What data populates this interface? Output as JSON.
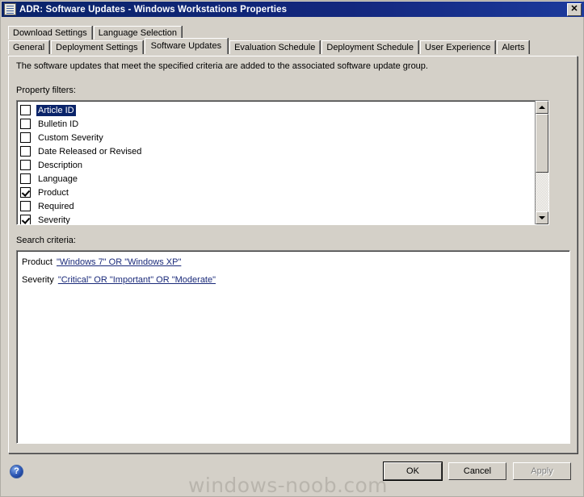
{
  "window": {
    "title": "ADR: Software Updates - Windows Workstations Properties",
    "icon": "properties-document-icon",
    "close_label": "✕"
  },
  "tabs": {
    "row1": [
      {
        "label": "Download Settings",
        "active": false
      },
      {
        "label": "Language Selection",
        "active": false
      }
    ],
    "row2": [
      {
        "label": "General",
        "active": false
      },
      {
        "label": "Deployment Settings",
        "active": false
      },
      {
        "label": "Software Updates",
        "active": true
      },
      {
        "label": "Evaluation Schedule",
        "active": false
      },
      {
        "label": "Deployment Schedule",
        "active": false
      },
      {
        "label": "User Experience",
        "active": false
      },
      {
        "label": "Alerts",
        "active": false
      }
    ]
  },
  "panel": {
    "description": "The software updates that meet the specified criteria are added to the associated software update group.",
    "property_filters_label": "Property filters:",
    "search_criteria_label": "Search criteria:"
  },
  "property_filters": [
    {
      "label": "Article ID",
      "checked": false,
      "selected": true
    },
    {
      "label": "Bulletin ID",
      "checked": false,
      "selected": false
    },
    {
      "label": "Custom Severity",
      "checked": false,
      "selected": false
    },
    {
      "label": "Date Released or Revised",
      "checked": false,
      "selected": false
    },
    {
      "label": "Description",
      "checked": false,
      "selected": false
    },
    {
      "label": "Language",
      "checked": false,
      "selected": false
    },
    {
      "label": "Product",
      "checked": true,
      "selected": false
    },
    {
      "label": "Required",
      "checked": false,
      "selected": false
    },
    {
      "label": "Severity",
      "checked": true,
      "selected": false
    }
  ],
  "scrollbar": {
    "up_arrow": "scroll-up-arrow-icon",
    "down_arrow": "scroll-down-arrow-icon",
    "thumb_position_percent": 0
  },
  "search_criteria": [
    {
      "property": "Product",
      "value": "\"Windows 7\" OR \"Windows XP\""
    },
    {
      "property": "Severity",
      "value": "\"Critical\" OR \"Important\" OR \"Moderate\""
    }
  ],
  "footer": {
    "help_label": "?",
    "watermark": "windows-noob.com",
    "ok_label": "OK",
    "cancel_label": "Cancel",
    "apply_label": "Apply"
  },
  "colors": {
    "titlebar_start": "#0a246a",
    "titlebar_end": "#1c3a9c",
    "dialog_face": "#d4d0c8",
    "selection": "#0a246a",
    "link": "#1a2a7a",
    "disabled_text": "#808080",
    "watermark": "#b9b5ad"
  }
}
